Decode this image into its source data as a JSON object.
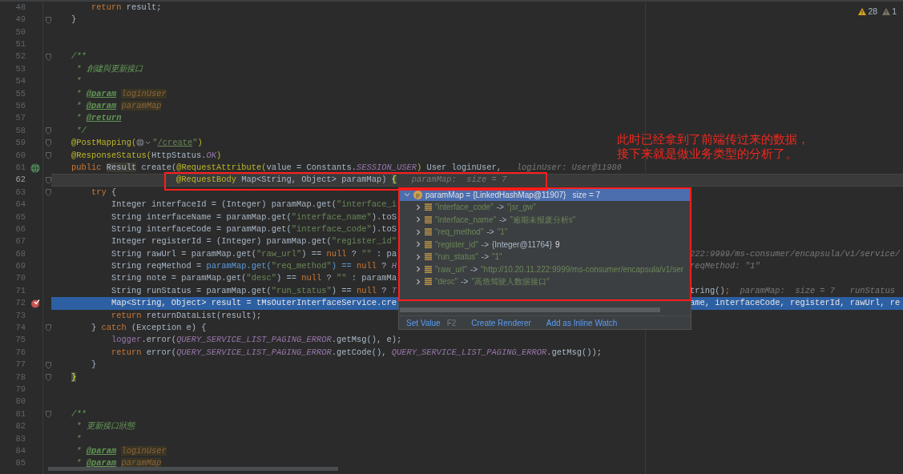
{
  "inspections": {
    "warnings": "28",
    "weak_warnings": "1"
  },
  "lines": [
    {
      "number": "48",
      "fold": false,
      "breakpoint": false,
      "endpoint": false,
      "current": false,
      "execution_point": false,
      "code": [
        {
          "kind": "kw",
          "text": "        return"
        },
        {
          "kind": "plain",
          "text": " result;"
        }
      ]
    },
    {
      "number": "49",
      "fold": true,
      "breakpoint": false,
      "endpoint": false,
      "current": false,
      "execution_point": false,
      "code": [
        {
          "kind": "plain",
          "text": "    }"
        }
      ]
    },
    {
      "number": "50",
      "fold": false,
      "breakpoint": false,
      "endpoint": false,
      "current": false,
      "execution_point": false
    },
    {
      "number": "51",
      "fold": false,
      "breakpoint": false,
      "endpoint": false,
      "current": false,
      "execution_point": false
    },
    {
      "number": "52",
      "fold": true,
      "breakpoint": false,
      "endpoint": false,
      "current": false,
      "execution_point": false,
      "code": [
        {
          "kind": "doc",
          "text": "    /**"
        }
      ]
    },
    {
      "number": "53",
      "fold": false,
      "breakpoint": false,
      "endpoint": false,
      "current": false,
      "execution_point": false,
      "code": [
        {
          "kind": "doc",
          "text": "     * 創建與更新接口"
        }
      ]
    },
    {
      "number": "54",
      "fold": false,
      "breakpoint": false,
      "endpoint": false,
      "current": false,
      "execution_point": false,
      "code": [
        {
          "kind": "doc",
          "text": "     *"
        }
      ]
    },
    {
      "number": "55",
      "fold": false,
      "breakpoint": false,
      "endpoint": false,
      "current": false,
      "execution_point": false,
      "code": [
        {
          "kind": "doc",
          "text": "     * "
        },
        {
          "kind": "doctag",
          "text": "@param"
        },
        {
          "kind": "docparam",
          "text": "loginUser"
        }
      ]
    },
    {
      "number": "56",
      "fold": false,
      "breakpoint": false,
      "endpoint": false,
      "current": false,
      "execution_point": false,
      "code": [
        {
          "kind": "doc",
          "text": "     * "
        },
        {
          "kind": "doctag",
          "text": "@param"
        },
        {
          "kind": "docparam",
          "text": "paramMap"
        }
      ]
    },
    {
      "number": "57",
      "fold": false,
      "breakpoint": false,
      "endpoint": false,
      "current": false,
      "execution_point": false,
      "code": [
        {
          "kind": "doc",
          "text": "     * "
        },
        {
          "kind": "doctag",
          "text": "@return"
        }
      ]
    },
    {
      "number": "58",
      "fold": true,
      "breakpoint": false,
      "endpoint": false,
      "current": false,
      "execution_point": false,
      "code": [
        {
          "kind": "doc",
          "text": "     */"
        }
      ]
    },
    {
      "number": "59",
      "fold": true,
      "breakpoint": false,
      "endpoint": false,
      "current": false,
      "execution_point": false,
      "code": [
        {
          "kind": "ann",
          "text": "    @PostMapping("
        },
        {
          "kind": "globe"
        },
        {
          "kind": "str",
          "text": "\""
        },
        {
          "kind": "link",
          "text": "/create"
        },
        {
          "kind": "str",
          "text": "\""
        },
        {
          "kind": "ann",
          "text": ")"
        }
      ]
    },
    {
      "number": "60",
      "fold": true,
      "breakpoint": false,
      "endpoint": false,
      "current": false,
      "execution_point": false,
      "code": [
        {
          "kind": "ann",
          "text": "    @ResponseStatus("
        },
        {
          "kind": "plain",
          "text": "HttpStatus."
        },
        {
          "kind": "const",
          "text": "OK"
        },
        {
          "kind": "ann",
          "text": ")"
        }
      ]
    },
    {
      "number": "61",
      "fold": false,
      "breakpoint": false,
      "endpoint": true,
      "current": false,
      "execution_point": false,
      "code": [
        {
          "kind": "kw",
          "text": "    public "
        },
        {
          "kind": "usage",
          "text": "Result"
        },
        {
          "kind": "plain",
          "text": " create("
        },
        {
          "kind": "ann",
          "text": "@RequestAttribute("
        },
        {
          "kind": "plain",
          "text": "value = Constants."
        },
        {
          "kind": "const",
          "text": "SESSION_USER"
        },
        {
          "kind": "ann",
          "text": ")"
        },
        {
          "kind": "plain",
          "text": " User loginUser,"
        },
        {
          "kind": "hint",
          "text": "   loginUser: User@11986"
        }
      ]
    },
    {
      "number": "62",
      "fold": true,
      "breakpoint": false,
      "endpoint": false,
      "current": true,
      "execution_point": false,
      "code": [
        {
          "kind": "ann",
          "text": "                         @RequestBody"
        },
        {
          "kind": "plain",
          "text": " Map<String, Object> paramMap) "
        },
        {
          "kind": "brace",
          "text": "{"
        },
        {
          "kind": "hint",
          "text": "   paramMap:  size = 7"
        }
      ]
    },
    {
      "number": "63",
      "fold": true,
      "breakpoint": false,
      "endpoint": false,
      "current": false,
      "execution_point": false,
      "code": [
        {
          "kind": "kw",
          "text": "        try"
        },
        {
          "kind": "plain",
          "text": " {"
        }
      ]
    },
    {
      "number": "64",
      "fold": false,
      "breakpoint": false,
      "endpoint": false,
      "current": false,
      "execution_point": false,
      "code": [
        {
          "kind": "plain",
          "text": "            Integer interfaceId = (Integer) paramMap.get("
        },
        {
          "kind": "str",
          "text": "\"interface_i"
        }
      ]
    },
    {
      "number": "65",
      "fold": false,
      "breakpoint": false,
      "endpoint": false,
      "current": false,
      "execution_point": false,
      "code": [
        {
          "kind": "plain",
          "text": "            String interfaceName = paramMap.get("
        },
        {
          "kind": "str",
          "text": "\"interface_name\""
        },
        {
          "kind": "plain",
          "text": ").toS"
        }
      ]
    },
    {
      "number": "66",
      "fold": false,
      "breakpoint": false,
      "endpoint": false,
      "current": false,
      "execution_point": false,
      "code": [
        {
          "kind": "plain",
          "text": "            String interfaceCode = paramMap.get("
        },
        {
          "kind": "str",
          "text": "\"interface_code\""
        },
        {
          "kind": "plain",
          "text": ").toS"
        }
      ]
    },
    {
      "number": "67",
      "fold": false,
      "breakpoint": false,
      "endpoint": false,
      "current": false,
      "execution_point": false,
      "code": [
        {
          "kind": "plain",
          "text": "            Integer registerId = (Integer) paramMap.get("
        },
        {
          "kind": "str",
          "text": "\"register_id\""
        }
      ]
    },
    {
      "number": "68",
      "fold": false,
      "breakpoint": false,
      "endpoint": false,
      "current": false,
      "execution_point": false,
      "code": [
        {
          "kind": "plain",
          "text": "            String rawUrl = paramMap.get("
        },
        {
          "kind": "str",
          "text": "\"raw_url\""
        },
        {
          "kind": "plain",
          "text": ") == "
        },
        {
          "kind": "kw",
          "text": "null"
        },
        {
          "kind": "plain",
          "text": " ? "
        },
        {
          "kind": "str",
          "text": "\"\""
        },
        {
          "kind": "plain",
          "text": " : pa"
        }
      ],
      "after_popup": [
        {
          "kind": "hint",
          "text": "222:9999/ms-consumer/encapsula/v1/service/"
        }
      ]
    },
    {
      "number": "69",
      "fold": false,
      "breakpoint": false,
      "endpoint": false,
      "current": false,
      "execution_point": false,
      "code": [
        {
          "kind": "plain",
          "text": "            String reqMethod = "
        },
        {
          "kind": "call",
          "text": "paramMap.get("
        },
        {
          "kind": "str",
          "text": "\"req_method\""
        },
        {
          "kind": "call",
          "text": ") == "
        },
        {
          "kind": "kw",
          "text": "null"
        },
        {
          "kind": "plain",
          "text": " ? "
        },
        {
          "kind": "const",
          "text": "H"
        }
      ],
      "after_popup": [
        {
          "kind": "hint",
          "text": "reqMethod: \"1\""
        }
      ]
    },
    {
      "number": "70",
      "fold": false,
      "breakpoint": false,
      "endpoint": false,
      "current": false,
      "execution_point": false,
      "code": [
        {
          "kind": "plain",
          "text": "            String note = paramMap.get("
        },
        {
          "kind": "str",
          "text": "\"desc\""
        },
        {
          "kind": "plain",
          "text": ") == "
        },
        {
          "kind": "kw",
          "text": "null"
        },
        {
          "kind": "plain",
          "text": " ? "
        },
        {
          "kind": "str",
          "text": "\"\""
        },
        {
          "kind": "plain",
          "text": " : paramMa"
        }
      ]
    },
    {
      "number": "71",
      "fold": false,
      "breakpoint": false,
      "endpoint": false,
      "current": false,
      "execution_point": false,
      "code": [
        {
          "kind": "plain",
          "text": "            String runStatus = paramMap.get("
        },
        {
          "kind": "str",
          "text": "\"run_status\""
        },
        {
          "kind": "plain",
          "text": ") == "
        },
        {
          "kind": "kw",
          "text": "null"
        },
        {
          "kind": "plain",
          "text": " ? "
        },
        {
          "kind": "const",
          "text": "T"
        }
      ],
      "after_popup": [
        {
          "kind": "plain",
          "text": "tring()"
        },
        {
          "kind": "kw",
          "text": ";"
        },
        {
          "kind": "hint",
          "text": "  paramMap:  size = 7   runStatus"
        }
      ]
    },
    {
      "number": "72",
      "fold": false,
      "breakpoint": true,
      "endpoint": false,
      "current": false,
      "execution_point": true,
      "code": [
        {
          "kind": "plain",
          "text": "            Map<String, Object> result = "
        },
        {
          "kind": "field",
          "text": "tMsOuterInterfaceService"
        },
        {
          "kind": "plain",
          "text": ".cre"
        }
      ],
      "after_popup": [
        {
          "kind": "plain",
          "text": "ame, interfaceCode, registerId, rawUrl, re"
        }
      ]
    },
    {
      "number": "73",
      "fold": false,
      "breakpoint": false,
      "endpoint": false,
      "current": false,
      "execution_point": false,
      "code": [
        {
          "kind": "kw",
          "text": "            return"
        },
        {
          "kind": "plain",
          "text": " returnDataList(result);"
        }
      ]
    },
    {
      "number": "74",
      "fold": true,
      "breakpoint": false,
      "endpoint": false,
      "current": false,
      "execution_point": false,
      "code": [
        {
          "kind": "plain",
          "text": "        } "
        },
        {
          "kind": "kw",
          "text": "catch"
        },
        {
          "kind": "plain",
          "text": " (Exception e) {"
        }
      ]
    },
    {
      "number": "75",
      "fold": false,
      "breakpoint": false,
      "endpoint": false,
      "current": false,
      "execution_point": false,
      "code": [
        {
          "kind": "field",
          "text": "            logger"
        },
        {
          "kind": "plain",
          "text": ".error("
        },
        {
          "kind": "const",
          "text": "QUERY_SERVICE_LIST_PAGING_ERROR"
        },
        {
          "kind": "plain",
          "text": ".getMsg(), e);"
        }
      ]
    },
    {
      "number": "76",
      "fold": false,
      "breakpoint": false,
      "endpoint": false,
      "current": false,
      "execution_point": false,
      "code": [
        {
          "kind": "kw",
          "text": "            return"
        },
        {
          "kind": "plain",
          "text": " error("
        },
        {
          "kind": "const",
          "text": "QUERY_SERVICE_LIST_PAGING_ERROR"
        },
        {
          "kind": "plain",
          "text": ".getCode(), "
        },
        {
          "kind": "const",
          "text": "QUERY_SERVICE_LIST_PAGING_ERROR"
        },
        {
          "kind": "plain",
          "text": ".getMsg());"
        }
      ]
    },
    {
      "number": "77",
      "fold": true,
      "breakpoint": false,
      "endpoint": false,
      "current": false,
      "execution_point": false,
      "code": [
        {
          "kind": "plain",
          "text": "        }"
        }
      ]
    },
    {
      "number": "78",
      "fold": true,
      "breakpoint": false,
      "endpoint": false,
      "current": false,
      "execution_point": false,
      "code": [
        {
          "kind": "closing_brace",
          "text": "}"
        }
      ]
    },
    {
      "number": "79",
      "fold": false,
      "breakpoint": false,
      "endpoint": false,
      "current": false,
      "execution_point": false
    },
    {
      "number": "80",
      "fold": false,
      "breakpoint": false,
      "endpoint": false,
      "current": false,
      "execution_point": false
    },
    {
      "number": "81",
      "fold": true,
      "breakpoint": false,
      "endpoint": false,
      "current": false,
      "execution_point": false,
      "code": [
        {
          "kind": "doc",
          "text": "    /**"
        }
      ]
    },
    {
      "number": "82",
      "fold": false,
      "breakpoint": false,
      "endpoint": false,
      "current": false,
      "execution_point": false,
      "code": [
        {
          "kind": "doc",
          "text": "     * 更新接口狀態"
        }
      ]
    },
    {
      "number": "83",
      "fold": false,
      "breakpoint": false,
      "endpoint": false,
      "current": false,
      "execution_point": false,
      "code": [
        {
          "kind": "doc",
          "text": "     *"
        }
      ]
    },
    {
      "number": "84",
      "fold": false,
      "breakpoint": false,
      "endpoint": false,
      "current": false,
      "execution_point": false,
      "code": [
        {
          "kind": "doc",
          "text": "     * "
        },
        {
          "kind": "doctag",
          "text": "@param"
        },
        {
          "kind": "docparam",
          "text": "loginUser"
        }
      ]
    },
    {
      "number": "85",
      "fold": false,
      "breakpoint": false,
      "endpoint": false,
      "current": false,
      "execution_point": false,
      "code": [
        {
          "kind": "doc",
          "text": "     * "
        },
        {
          "kind": "doctag",
          "text": "@param"
        },
        {
          "kind": "docparam",
          "text": "paramMap"
        }
      ]
    }
  ],
  "debug_popup": {
    "root": {
      "badge": "p",
      "name": "paramMap = ",
      "ref": "{LinkedHashMap@11907}",
      "size": "size = 7",
      "expanded": true,
      "selected": true
    },
    "entries": [
      {
        "key": "\"interface_code\"",
        "arrow": "->",
        "value": "\"jsr_gw\"",
        "expanded": false
      },
      {
        "key": "\"interface_name\"",
        "arrow": "->",
        "value": "\"逾期未报废分析s\"",
        "expanded": false
      },
      {
        "key": "\"req_method\"",
        "arrow": "->",
        "value": "\"1\"",
        "expanded": false
      },
      {
        "key": "\"register_id\"",
        "arrow": "->",
        "ref": "{Integer@11764}",
        "value": "9",
        "expanded": false
      },
      {
        "key": "\"run_status\"",
        "arrow": "->",
        "value": "\"1\"",
        "expanded": false
      },
      {
        "key": "\"raw_url\"",
        "arrow": "->",
        "value": "\"http://10.20.11.222:9999/ms-consumer/encapsula/v1/ser",
        "expanded": false
      },
      {
        "key": "\"desc\"",
        "arrow": "->",
        "value": "\"高危驾驶人数据接口\"",
        "expanded": false
      }
    ],
    "actions": [
      {
        "label": "Set Value",
        "shortcut": "F2"
      },
      {
        "label": "Create Renderer"
      },
      {
        "label": "Add as Inline Watch"
      }
    ]
  },
  "annotation": [
    "此时已经拿到了前端传过来的数据，",
    "接下来就是做业务类型的分析了。"
  ]
}
